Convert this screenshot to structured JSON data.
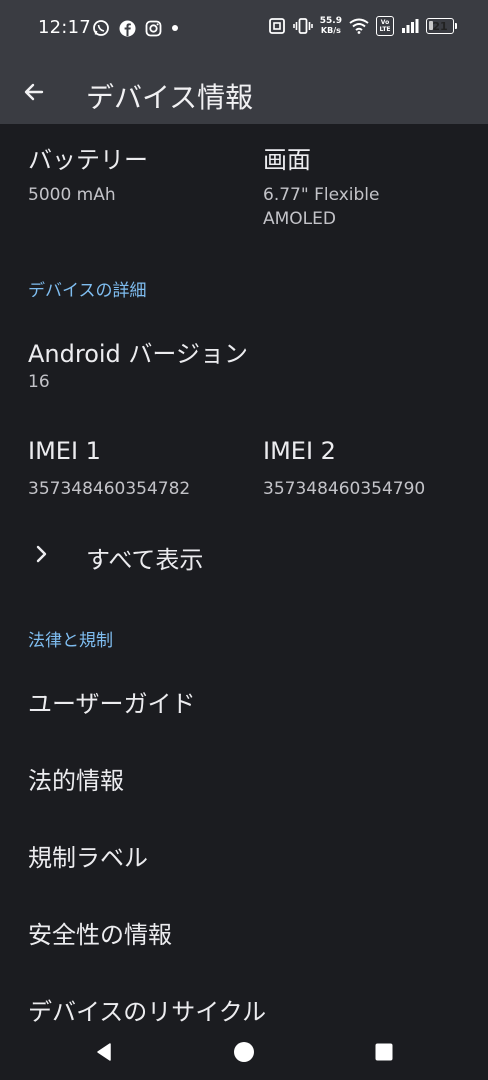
{
  "status_bar": {
    "time": "12:17",
    "network_speed_value": "55.9",
    "network_speed_unit": "KB/s",
    "volte_top": "Vo",
    "volte_bottom": "LTE",
    "battery_level": "21",
    "battery_fraction": 0.21
  },
  "app_bar": {
    "title": "デバイス情報"
  },
  "content": {
    "battery": {
      "title": "バッテリー",
      "value": "5000 mAh"
    },
    "screen": {
      "title": "画面",
      "value_line1": "6.77\" Flexible",
      "value_line2": "AMOLED"
    },
    "section_device_details": "デバイスの詳細",
    "android_version": {
      "title": "Android バージョン",
      "value": "16"
    },
    "imei1": {
      "title": "IMEI 1",
      "value": "357348460354782"
    },
    "imei2": {
      "title": "IMEI 2",
      "value": "357348460354790"
    },
    "show_all": "すべて表示",
    "section_legal": "法律と規制",
    "legal_items": [
      "ユーザーガイド",
      "法的情報",
      "規制ラベル",
      "安全性の情報",
      "デバイスのリサイクル"
    ]
  },
  "icons": {
    "back": "arrow-left-icon",
    "chevron": "chevron-right-icon",
    "nav_back": "triangle-back-icon",
    "nav_home": "circle-home-icon",
    "nav_recents": "square-recents-icon"
  }
}
